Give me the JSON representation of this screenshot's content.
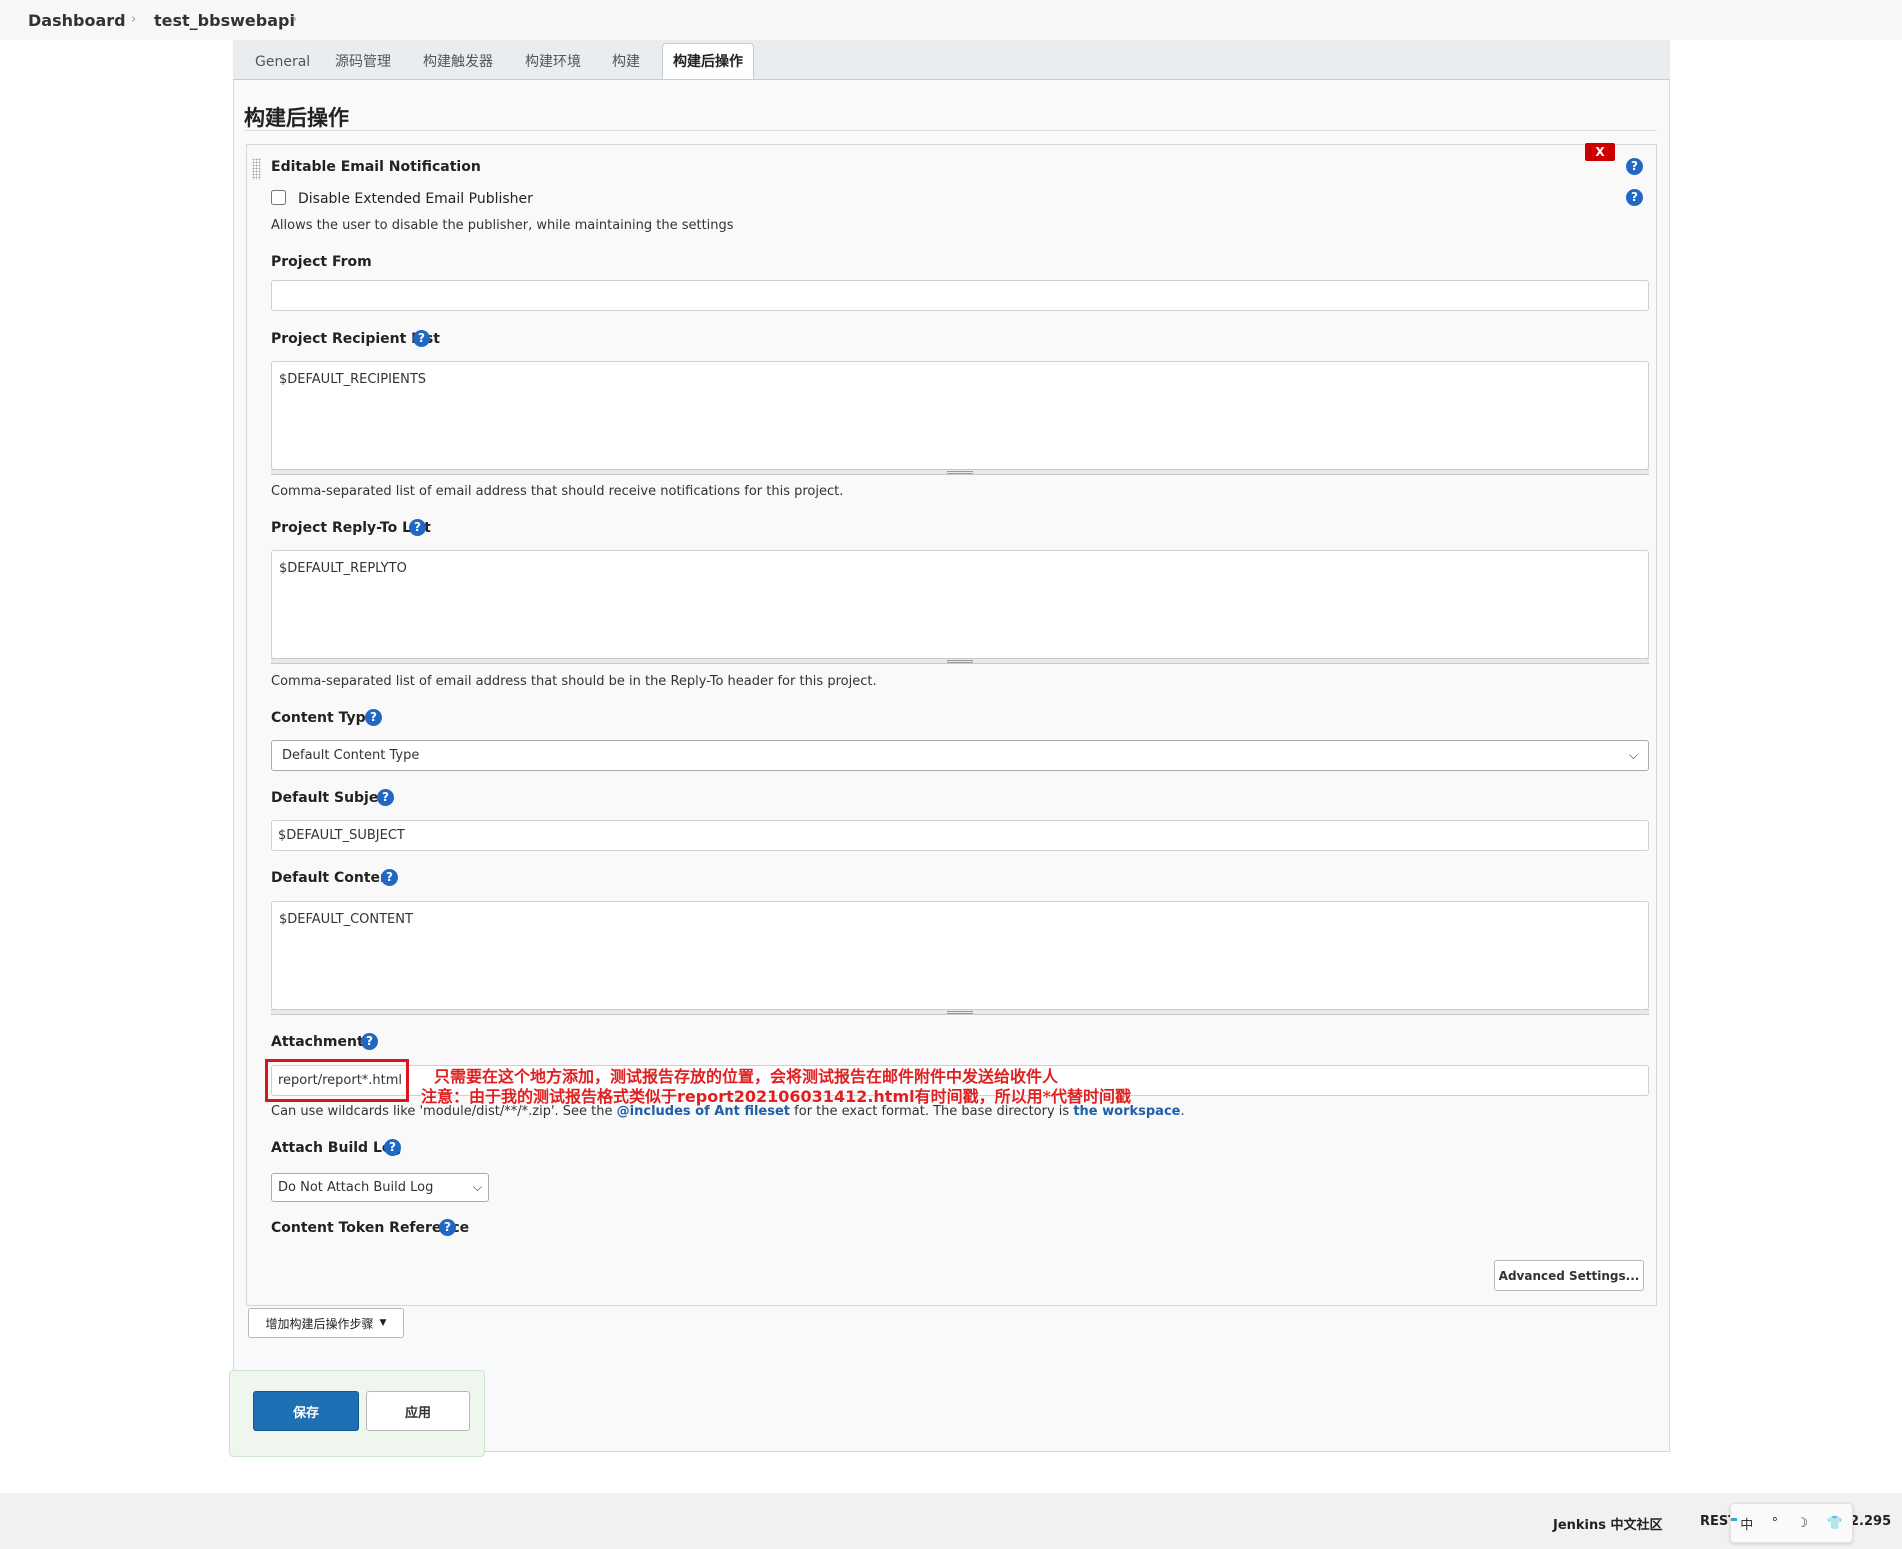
{
  "breadcrumb": {
    "items": [
      "Dashboard",
      "test_bbswebapi"
    ]
  },
  "tabs": [
    {
      "label": "General",
      "active": false
    },
    {
      "label": "源码管理",
      "active": false
    },
    {
      "label": "构建触发器",
      "active": false
    },
    {
      "label": "构建环境",
      "active": false
    },
    {
      "label": "构建",
      "active": false
    },
    {
      "label": "构建后操作",
      "active": true
    }
  ],
  "section": {
    "title": "构建后操作"
  },
  "publisher": {
    "title": "Editable Email Notification",
    "delete_label": "X",
    "disable_checkbox": {
      "label": "Disable Extended Email Publisher",
      "checked": false
    },
    "disable_desc": "Allows the user to disable the publisher, while maintaining the settings",
    "project_from": {
      "label": "Project From",
      "value": ""
    },
    "recipient_list": {
      "label": "Project Recipient List",
      "value": "$DEFAULT_RECIPIENTS",
      "desc": "Comma-separated list of email address that should receive notifications for this project."
    },
    "reply_to": {
      "label": "Project Reply-To List",
      "value": "$DEFAULT_REPLYTO",
      "desc": "Comma-separated list of email address that should be in the Reply-To header for this project."
    },
    "content_type": {
      "label": "Content Type",
      "value": "Default Content Type"
    },
    "default_subject": {
      "label": "Default Subject",
      "value": "$DEFAULT_SUBJECT"
    },
    "default_content": {
      "label": "Default Content",
      "value": "$DEFAULT_CONTENT"
    },
    "attachments": {
      "label": "Attachments",
      "value": "report/report*.html",
      "desc_prefix": "Can use wildcards like 'module/dist/**/*.zip'. See the ",
      "desc_link1": "@includes of Ant fileset",
      "desc_mid": " for the exact format. The base directory is ",
      "desc_link2": "the workspace",
      "desc_suffix": "."
    },
    "attach_build_log": {
      "label": "Attach Build Log",
      "value": "Do Not Attach Build Log"
    },
    "content_token_reference": {
      "label": "Content Token Reference"
    },
    "advanced_button": "Advanced Settings..."
  },
  "add_step_button": "增加构建后操作步骤",
  "actions": {
    "save": "保存",
    "apply": "应用"
  },
  "annotation": {
    "line1": "只需要在这个地方添加，测试报告存放的位置，会将测试报告在邮件附件中发送给收件人",
    "line2_prefix": "注意：由于我的测试报告格式类似于",
    "line2_bold": "report202106031412.html",
    "line2_suffix": "有时间戳，所以用*代替时间戳"
  },
  "footer": {
    "community": "Jenkins 中文社区",
    "rest": "REST",
    "version_fragment": "2.295",
    "ime": {
      "items": [
        "中",
        "°",
        "☽",
        "👕"
      ]
    }
  },
  "colors": {
    "accent": "#1f6fb5",
    "help_icon": "#2168c4",
    "delete": "#cc0000",
    "annotation": "#e02020"
  }
}
